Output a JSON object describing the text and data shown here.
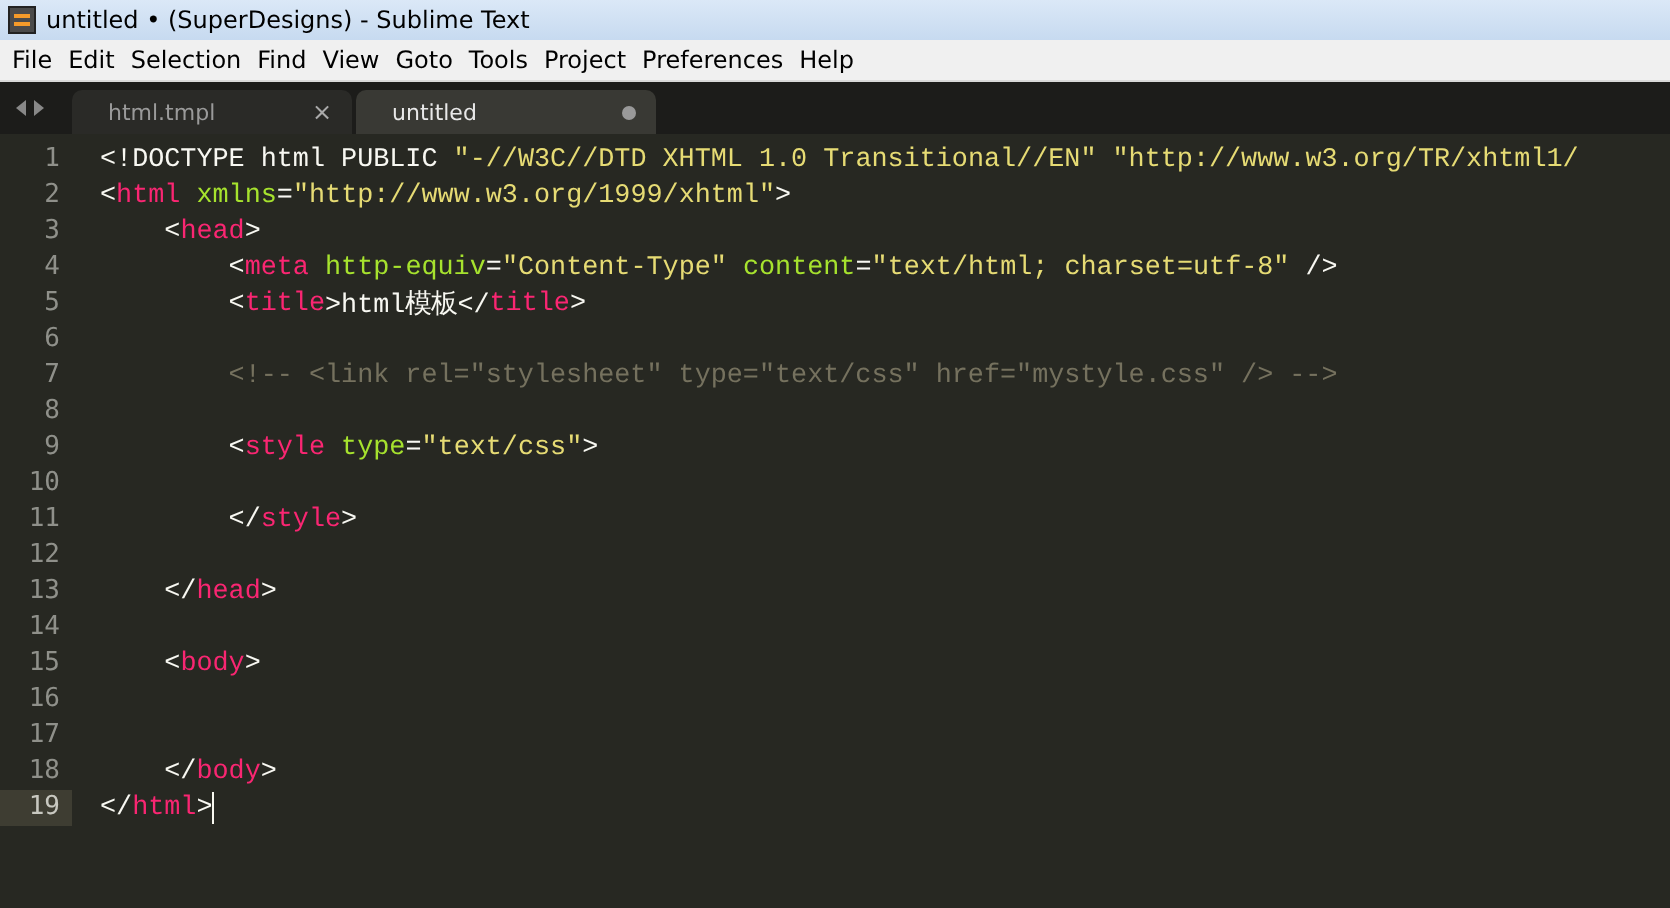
{
  "window": {
    "title": "untitled • (SuperDesigns) - Sublime Text"
  },
  "menu": [
    "File",
    "Edit",
    "Selection",
    "Find",
    "View",
    "Goto",
    "Tools",
    "Project",
    "Preferences",
    "Help"
  ],
  "tabs": [
    {
      "label": "html.tmpl",
      "selected": false,
      "modified": false,
      "close": "×"
    },
    {
      "label": "untitled",
      "selected": true,
      "modified": true
    }
  ],
  "editor": {
    "lines": [
      {
        "number": "1",
        "current": false,
        "tokens": [
          {
            "kind": "punct",
            "text": "<!DOCTYPE html PUBLIC "
          },
          {
            "kind": "string",
            "text": "\"-//W3C//DTD XHTML 1.0 Transitional//EN\" \"http://www.w3.org/TR/xhtml1/"
          }
        ]
      },
      {
        "number": "2",
        "current": false,
        "tokens": [
          {
            "kind": "punct",
            "text": "<"
          },
          {
            "kind": "tag",
            "text": "html"
          },
          {
            "kind": "attr",
            "text": " xmlns"
          },
          {
            "kind": "punct",
            "text": "="
          },
          {
            "kind": "string",
            "text": "\"http://www.w3.org/1999/xhtml\""
          },
          {
            "kind": "punct",
            "text": ">"
          }
        ]
      },
      {
        "number": "3",
        "current": false,
        "tokens": [
          {
            "kind": "punct",
            "text": "    <"
          },
          {
            "kind": "tag",
            "text": "head"
          },
          {
            "kind": "punct",
            "text": ">"
          }
        ]
      },
      {
        "number": "4",
        "current": false,
        "tokens": [
          {
            "kind": "punct",
            "text": "        <"
          },
          {
            "kind": "tag",
            "text": "meta"
          },
          {
            "kind": "attr",
            "text": " http-equiv"
          },
          {
            "kind": "punct",
            "text": "="
          },
          {
            "kind": "string",
            "text": "\"Content-Type\""
          },
          {
            "kind": "attr",
            "text": " content"
          },
          {
            "kind": "punct",
            "text": "="
          },
          {
            "kind": "string",
            "text": "\"text/html; charset=utf-8\""
          },
          {
            "kind": "punct",
            "text": " />"
          }
        ]
      },
      {
        "number": "5",
        "current": false,
        "tokens": [
          {
            "kind": "punct",
            "text": "        <"
          },
          {
            "kind": "tag",
            "text": "title"
          },
          {
            "kind": "punct",
            "text": ">html模板</"
          },
          {
            "kind": "tag",
            "text": "title"
          },
          {
            "kind": "punct",
            "text": ">"
          }
        ]
      },
      {
        "number": "6",
        "current": false
      },
      {
        "number": "7",
        "current": false,
        "tokens": [
          {
            "kind": "comment",
            "text": "        <!-- <link rel=\"stylesheet\" type=\"text/css\" href=\"mystyle.css\" /> -->"
          }
        ]
      },
      {
        "number": "8",
        "current": false
      },
      {
        "number": "9",
        "current": false,
        "tokens": [
          {
            "kind": "punct",
            "text": "        <"
          },
          {
            "kind": "tag",
            "text": "style"
          },
          {
            "kind": "attr",
            "text": " type"
          },
          {
            "kind": "punct",
            "text": "="
          },
          {
            "kind": "string",
            "text": "\"text/css\""
          },
          {
            "kind": "punct",
            "text": ">"
          }
        ]
      },
      {
        "number": "10",
        "current": false
      },
      {
        "number": "11",
        "current": false,
        "tokens": [
          {
            "kind": "punct",
            "text": "        </"
          },
          {
            "kind": "tag",
            "text": "style"
          },
          {
            "kind": "punct",
            "text": ">"
          }
        ]
      },
      {
        "number": "12",
        "current": false
      },
      {
        "number": "13",
        "current": false,
        "tokens": [
          {
            "kind": "punct",
            "text": "    </"
          },
          {
            "kind": "tag",
            "text": "head"
          },
          {
            "kind": "punct",
            "text": ">"
          }
        ]
      },
      {
        "number": "14",
        "current": false
      },
      {
        "number": "15",
        "current": false,
        "tokens": [
          {
            "kind": "punct",
            "text": "    <"
          },
          {
            "kind": "tag",
            "text": "body"
          },
          {
            "kind": "punct",
            "text": ">"
          }
        ]
      },
      {
        "number": "16",
        "current": false
      },
      {
        "number": "17",
        "current": false
      },
      {
        "number": "18",
        "current": false,
        "tokens": [
          {
            "kind": "punct",
            "text": "    </"
          },
          {
            "kind": "tag",
            "text": "body"
          },
          {
            "kind": "punct",
            "text": ">"
          }
        ]
      },
      {
        "number": "19",
        "current": true,
        "tokens": [
          {
            "kind": "punct",
            "text": "</"
          },
          {
            "kind": "tag",
            "text": "html"
          },
          {
            "kind": "punct",
            "text": ">"
          }
        ]
      }
    ]
  }
}
